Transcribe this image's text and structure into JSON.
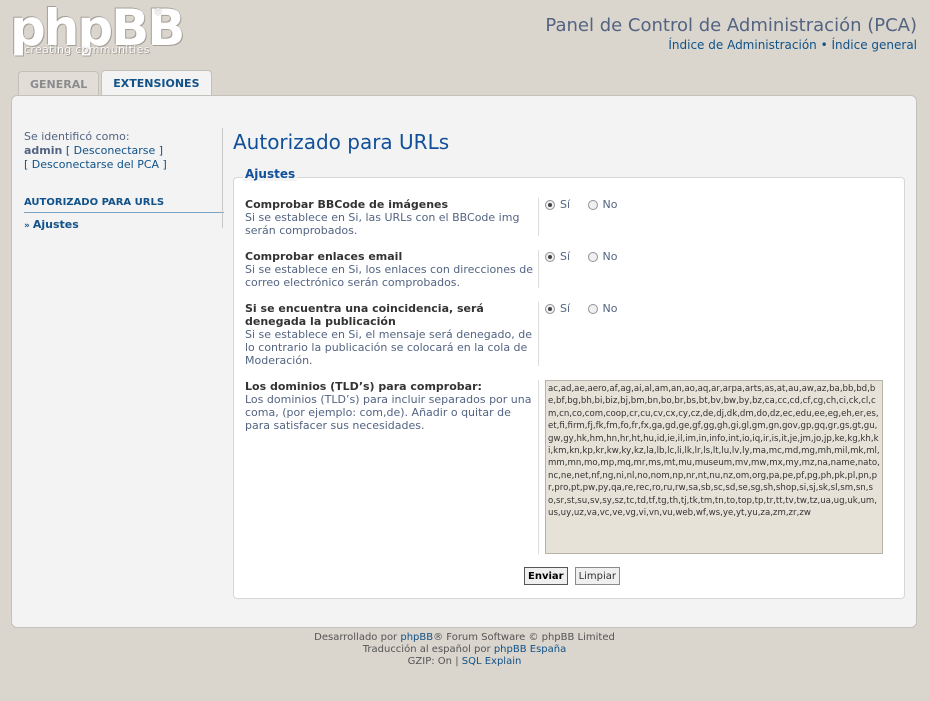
{
  "header": {
    "logo_text": "phpBB",
    "logo_reg": "®",
    "logo_tagline": "creating  communities",
    "title": "Panel de Control de Administración (PCA)",
    "link_admin_index": "Índice de Administración",
    "link_separator": "•",
    "link_board_index": "Índice general"
  },
  "tabs": [
    {
      "label": "GENERAL",
      "active": false
    },
    {
      "label": "EXTENSIONES",
      "active": true
    }
  ],
  "sidebar": {
    "identified_as": "Se identificó como:",
    "username": "admin",
    "logout_link": "[ Desconectarse ]",
    "logout_acp_link": "[ Desconectarse del PCA ]",
    "section_title": "AUTORIZADO PARA URLS",
    "item_label": "Ajustes",
    "item_marker": "»"
  },
  "content": {
    "page_title": "Autorizado para URLs",
    "fieldset_legend": "Ajustes",
    "settings": [
      {
        "title": "Comprobar BBCode de imágenes",
        "description": "Si se establece en Si, las URLs con el BBCode img serán comprobados.",
        "yes_label": "Sí",
        "no_label": "No",
        "selected": "yes"
      },
      {
        "title": "Comprobar enlaces email",
        "description": "Si se establece en Si, los enlaces con direcciones de correo electrónico serán comprobados.",
        "yes_label": "Sí",
        "no_label": "No",
        "selected": "yes"
      },
      {
        "title": "Si se encuentra una coincidencia, será denegada la publicación",
        "description": "Si se establece en Si, el mensaje será denegado, de lo contrario la publicación se colocará en la cola de Moderación.",
        "yes_label": "Sí",
        "no_label": "No",
        "selected": "yes"
      }
    ],
    "tld_setting": {
      "title": "Los dominios (TLD’s) para comprobar:",
      "description": "Los dominios (TLD’s) para incluir separados por una coma, (por ejemplo: com,de). Añadir o quitar de para satisfacer sus necesidades.",
      "value": "ac,ad,ae,aero,af,ag,ai,al,am,an,ao,aq,ar,arpa,arts,as,at,au,aw,az,ba,bb,bd,be,bf,bg,bh,bi,biz,bj,bm,bn,bo,br,bs,bt,bv,bw,by,bz,ca,cc,cd,cf,cg,ch,ci,ck,cl,cm,cn,co,com,coop,cr,cu,cv,cx,cy,cz,de,dj,dk,dm,do,dz,ec,edu,ee,eg,eh,er,es,et,fi,firm,fj,fk,fm,fo,fr,fx,ga,gd,ge,gf,gg,gh,gi,gl,gm,gn,gov,gp,gq,gr,gs,gt,gu,gw,gy,hk,hm,hn,hr,ht,hu,id,ie,il,im,in,info,int,io,iq,ir,is,it,je,jm,jo,jp,ke,kg,kh,ki,km,kn,kp,kr,kw,ky,kz,la,lb,lc,li,lk,lr,ls,lt,lu,lv,ly,ma,mc,md,mg,mh,mil,mk,ml,mm,mn,mo,mp,mq,mr,ms,mt,mu,museum,mv,mw,mx,my,mz,na,name,nato,nc,ne,net,nf,ng,ni,nl,no,nom,np,nr,nt,nu,nz,om,org,pa,pe,pf,pg,ph,pk,pl,pn,pr,pro,pt,pw,py,qa,re,rec,ro,ru,rw,sa,sb,sc,sd,se,sg,sh,shop,si,sj,sk,sl,sm,sn,so,sr,st,su,sv,sy,sz,tc,td,tf,tg,th,tj,tk,tm,tn,to,top,tp,tr,tt,tv,tw,tz,ua,ug,uk,um,us,uy,uz,va,vc,ve,vg,vi,vn,vu,web,wf,ws,ye,yt,yu,za,zm,zr,zw"
    },
    "submit_label": "Enviar",
    "reset_label": "Limpiar"
  },
  "footer": {
    "line1_prefix": "Desarrollado por ",
    "line1_link": "phpBB",
    "line1_suffix": "® Forum Software © phpBB Limited",
    "line2_prefix": "Traducción al español por ",
    "line2_link": "phpBB España",
    "line3_gzip": "GZIP: On",
    "line3_sep": " | ",
    "line3_sql": "SQL Explain"
  },
  "colors": {
    "background": "#dad5cd",
    "link": "#105289",
    "title": "#115098",
    "text": "#536482"
  }
}
